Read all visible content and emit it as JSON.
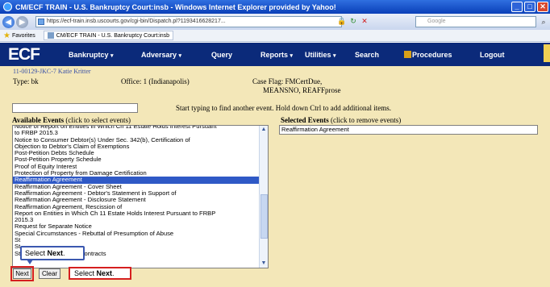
{
  "window": {
    "title": "CM/ECF TRAIN - U.S. Bankruptcy Court:insb - Windows Internet Explorer provided by Yahoo!",
    "minimize": "_",
    "maximize": "□",
    "close": "✕"
  },
  "browser": {
    "url": "https://ecf-train.insb.uscourts.gov/cgi-bin/Dispatch.pl?1193416628217...",
    "search_placeholder": "Google",
    "favorites_label": "Favorites",
    "tab_label": "CM/ECF TRAIN - U.S. Bankruptcy Court:insb"
  },
  "nav": {
    "logo": "ECF",
    "items": [
      {
        "label": "Bankruptcy",
        "caret": "▾"
      },
      {
        "label": "Adversary",
        "caret": "▾"
      },
      {
        "label": "Query",
        "caret": ""
      },
      {
        "label": "Reports",
        "caret": "▾"
      },
      {
        "label": "Utilities",
        "caret": "▾"
      },
      {
        "label": "Search",
        "caret": ""
      },
      {
        "label": "Procedures",
        "caret": ""
      },
      {
        "label": "Logout",
        "caret": ""
      }
    ]
  },
  "case": {
    "number": "11-00129-JKC-7 Katie Kritter",
    "type": "Type: bk",
    "office": "Office: 1 (Indianapolis)",
    "flags_line1": "Case Flag: FMCertDue,",
    "flags_line2": "MEANSNO, REAFFprose"
  },
  "filter": {
    "value": "",
    "hint": "Start typing to find another event. Hold down Ctrl to add additional items."
  },
  "available": {
    "heading": "Available Events",
    "hint": "(click to select events)",
    "items": [
      {
        "label": "Notice of Report on Entities in Which Ch 11 Estate Holds Interest Pursuant",
        "state": "normal"
      },
      {
        "label": "to FRBP 2015.3",
        "state": "normal"
      },
      {
        "label": "Notice to Consumer Debtor(s) Under Sec. 342(b), Certification of",
        "state": "normal"
      },
      {
        "label": "Objection to Debtor's Claim of Exemptions",
        "state": "normal"
      },
      {
        "label": "Post-Petition Debts Schedule",
        "state": "normal"
      },
      {
        "label": "Post-Petition Property Schedule",
        "state": "normal"
      },
      {
        "label": "Proof of Equity Interest",
        "state": "normal"
      },
      {
        "label": "Protection of Property from Damage Certification",
        "state": "normal"
      },
      {
        "label": "Reaffirmation Agreement",
        "state": "selected"
      },
      {
        "label": "Reaffirmation Agreement - Cover Sheet",
        "state": "normal"
      },
      {
        "label": "Reaffirmation Agreement - Debtor's Statement in Support of",
        "state": "normal"
      },
      {
        "label": "Reaffirmation Agreement - Disclosure Statement",
        "state": "normal"
      },
      {
        "label": "Reaffirmation Agreement, Rescission of",
        "state": "normal"
      },
      {
        "label": "Report on Entities in Which Ch 11 Estate Holds Interest Pursuant to FRBP",
        "state": "normal"
      },
      {
        "label": "2015.3",
        "state": "normal"
      },
      {
        "label": "Request for Separate Notice",
        "state": "normal"
      },
      {
        "label": "Special Circumstances - Rebuttal of Presumption of Abuse",
        "state": "normal"
      },
      {
        "label": "St",
        "state": "normal"
      },
      {
        "label": "St",
        "state": "normal"
      },
      {
        "label": "Statement of Executory Contracts",
        "state": "normal"
      }
    ]
  },
  "selected": {
    "heading": "Selected Events",
    "hint": "(click to remove events)",
    "items": [
      "Reaffirmation Agreement"
    ]
  },
  "buttons": {
    "next": "Next",
    "clear": "Clear"
  },
  "callouts": {
    "top_prefix": "Select ",
    "top_bold": "Next",
    "top_suffix": ".",
    "bottom_prefix": "Select ",
    "bottom_bold": "Next",
    "bottom_suffix": "."
  }
}
